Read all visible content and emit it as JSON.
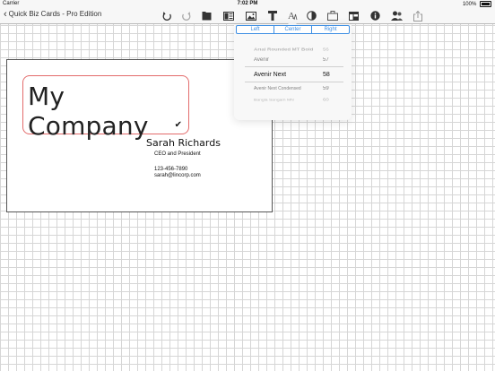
{
  "status": {
    "carrier": "Carrier",
    "time": "7:02 PM",
    "battery": "100%"
  },
  "nav": {
    "back_label": "Quick Biz Cards - Pro Edition"
  },
  "toolbar": [
    "undo-icon",
    "redo-icon",
    "folder-icon",
    "layout-icon",
    "image-icon",
    "shape-icon",
    "text-icon",
    "contrast-icon",
    "briefcase-icon",
    "template-icon",
    "info-icon",
    "people-icon",
    "share-icon"
  ],
  "popover": {
    "alignment": [
      "Left",
      "Center",
      "Right"
    ],
    "picker": [
      {
        "font": "Arial Rounded MT Bold",
        "size": "56"
      },
      {
        "font": "Avenir",
        "size": "57"
      },
      {
        "font": "Avenir Next",
        "size": "58"
      },
      {
        "font": "Avenir Next Condensed",
        "size": "59"
      },
      {
        "font": "Bangla Sangam MN",
        "size": "60"
      }
    ]
  },
  "card": {
    "company": "My Company",
    "name": "Sarah Richards",
    "title": "CEO and President",
    "phone": "123-456-7890",
    "email": "sarah@lincorp.com"
  },
  "colors": {
    "accent": "#3d8ee3",
    "selection_border": "#e36b6b"
  }
}
